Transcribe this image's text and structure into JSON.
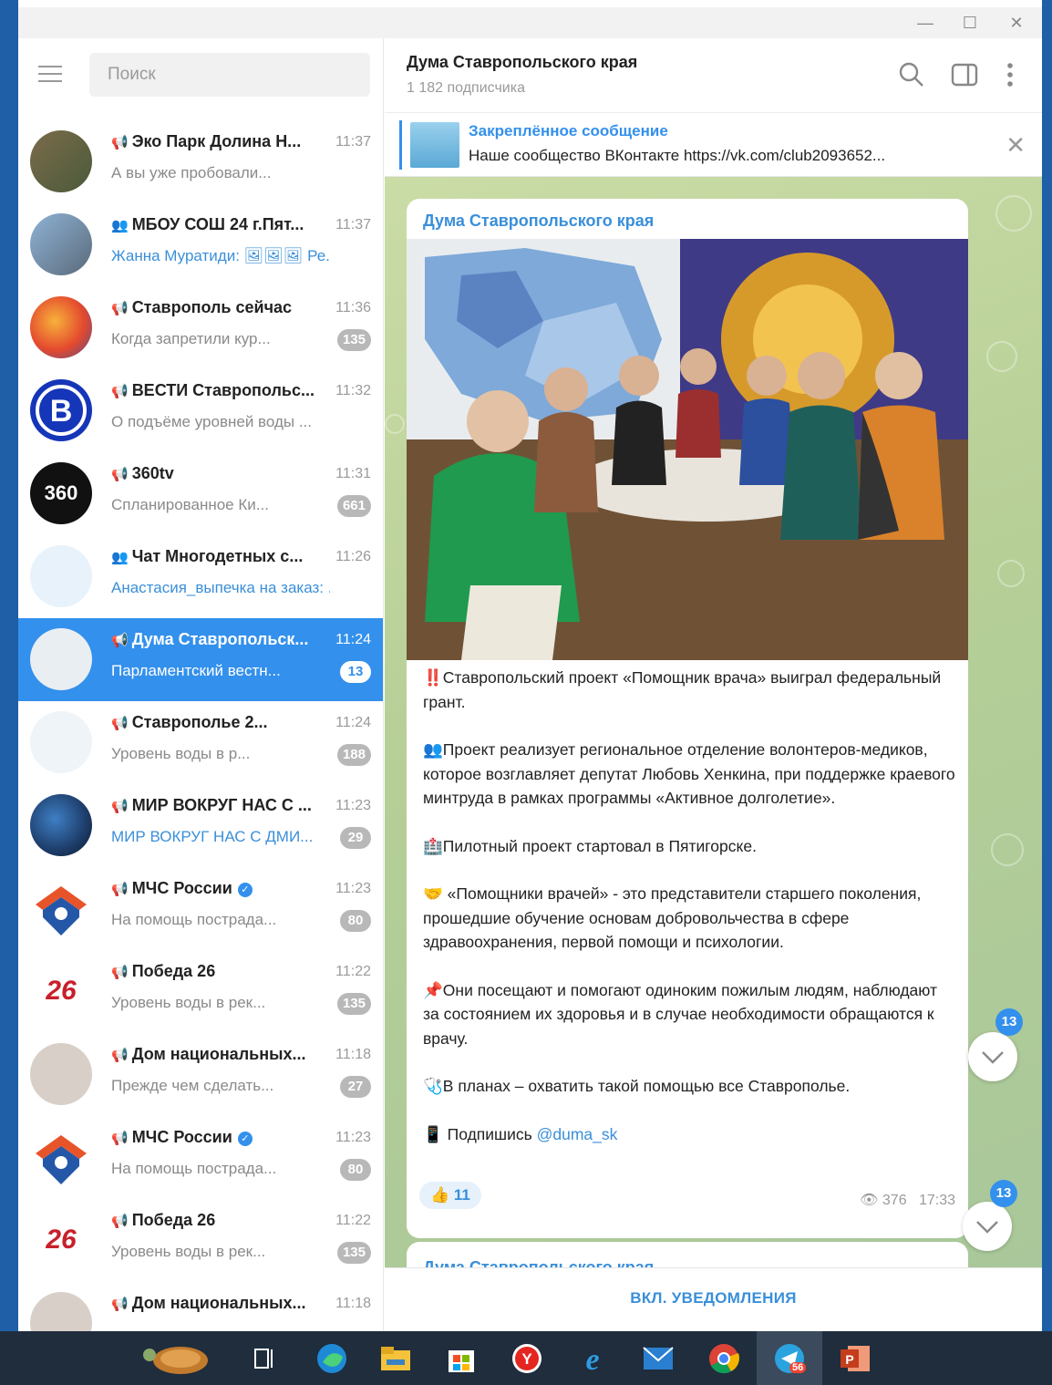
{
  "window": {
    "controls": [
      "—",
      "☐",
      "✕"
    ]
  },
  "search": {
    "placeholder": "Поиск"
  },
  "chats": [
    {
      "title": "Эко Парк Долина Н...",
      "time": "11:37",
      "preview": "А вы уже пробовали...",
      "badge": "",
      "type": "channel",
      "preview_color": "gray"
    },
    {
      "title": "МБОУ СОШ 24 г.Пят...",
      "time": "11:37",
      "preview": "Жанна Муратиди: 🖼🖼🖼 Ре...",
      "badge": "",
      "type": "group",
      "preview_color": "blue"
    },
    {
      "title": "Ставрополь сейчас",
      "time": "11:36",
      "preview": "Когда запретили кур...",
      "badge": "135",
      "type": "channel",
      "preview_color": "gray"
    },
    {
      "title": "ВЕСТИ Ставропольс...",
      "time": "11:32",
      "preview": "О подъёме уровней воды ...",
      "badge": "",
      "type": "channel",
      "preview_color": "gray"
    },
    {
      "title": "360tv",
      "time": "11:31",
      "preview": "Спланированное Ки...",
      "badge": "661",
      "type": "channel",
      "preview_color": "gray"
    },
    {
      "title": "Чат Многодетных с...",
      "time": "11:26",
      "preview": "Анастасия_выпечка на заказ: ...",
      "badge": "",
      "type": "group",
      "preview_color": "blue"
    },
    {
      "title": "Дума Ставропольск...",
      "time": "11:24",
      "preview": "Парламентский вестн...",
      "badge": "13",
      "type": "channel",
      "preview_color": "white",
      "active": true
    },
    {
      "title": "Ставрополье 2...",
      "time": "11:24",
      "preview": "Уровень воды в р...",
      "badge": "188",
      "type": "channel",
      "preview_color": "gray"
    },
    {
      "title": "МИР ВОКРУГ НАС С ...",
      "time": "11:23",
      "preview": "МИР ВОКРУГ НАС С ДМИ...",
      "badge": "29",
      "type": "channel",
      "preview_color": "blue"
    },
    {
      "title": "МЧС России",
      "time": "11:23",
      "preview": "На помощь пострада...",
      "badge": "80",
      "type": "channel",
      "preview_color": "gray",
      "verified": true
    },
    {
      "title": "Победа 26",
      "time": "11:22",
      "preview": "Уровень воды в рек...",
      "badge": "135",
      "type": "channel",
      "preview_color": "gray"
    },
    {
      "title": "Дом национальных...",
      "time": "11:18",
      "preview": "Прежде чем сделать...",
      "badge": "27",
      "type": "channel",
      "preview_color": "gray"
    },
    {
      "title": "МЧС России",
      "time": "11:23",
      "preview": "На помощь пострада...",
      "badge": "80",
      "type": "channel",
      "preview_color": "gray",
      "verified": true
    },
    {
      "title": "Победа 26",
      "time": "11:22",
      "preview": "Уровень воды в рек...",
      "badge": "135",
      "type": "channel",
      "preview_color": "gray"
    },
    {
      "title": "Дом национальных...",
      "time": "11:18",
      "preview": "",
      "badge": "",
      "type": "channel",
      "preview_color": "gray"
    }
  ],
  "header": {
    "title": "Дума Ставропольского края",
    "subscribers": "1 182 подписчика"
  },
  "pinned": {
    "title": "Закреплённое сообщение",
    "text": "Наше сообщество ВКонтакте   https://vk.com/club2093652..."
  },
  "message": {
    "author": "Дума Ставропольского края",
    "p1": "‼️Ставропольский проект «Помощник врача» выиграл федеральный грант.",
    "p2": "👥Проект реализует региональное отделение волонтеров-медиков, которое возглавляет депутат Любовь Хенкина, при поддержке краевого минтруда в рамках программы «Активное долголетие».",
    "p3": "🏥Пилотный проект стартовал в Пятигорске.",
    "p4": "🤝 «Помощники врачей» - это представители старшего поколения, прошедшие обучение основам добровольчества в сфере здравоохранения, первой помощи и психологии.",
    "p5": "📌Они посещают и помогают одиноким пожилым людям, наблюдают за состоянием их здоровья и в случае необходимости обращаются к врачу.",
    "p6": "🩺В планах – охватить такой помощью все Ставрополье.",
    "p7_prefix": "📱 Подпишись ",
    "p7_link": "@duma_sk",
    "reaction": "👍 11",
    "views": "376",
    "time": "17:33"
  },
  "message2": {
    "author": "Дума Ставропольского края"
  },
  "scroll": {
    "badge_top": "13",
    "badge_bottom": "13"
  },
  "footer": {
    "button": "ВКЛ. УВЕДОМЛЕНИЯ"
  },
  "taskbar": {
    "telegram_badge": "56"
  },
  "colors": {
    "accent": "#3390ec",
    "chat_bg": "#b6cf97",
    "taskbar": "#1f2d3d"
  }
}
